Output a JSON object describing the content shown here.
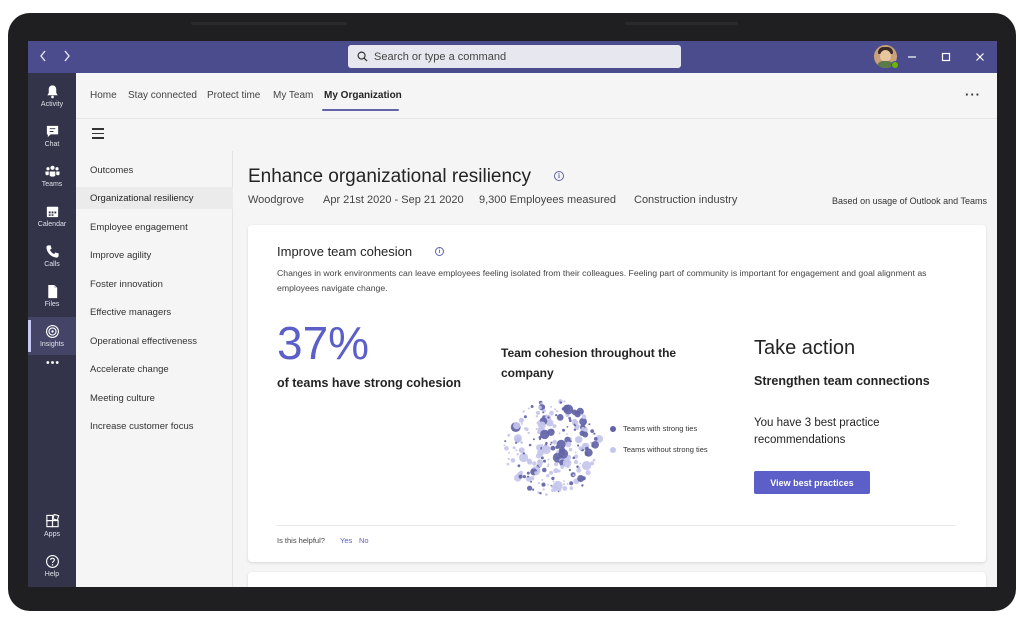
{
  "search": {
    "placeholder": "Search or type a command"
  },
  "rail": [
    {
      "label": "Activity",
      "icon": "bell-icon"
    },
    {
      "label": "Chat",
      "icon": "chat-icon"
    },
    {
      "label": "Teams",
      "icon": "teams-icon"
    },
    {
      "label": "Calendar",
      "icon": "calendar-icon"
    },
    {
      "label": "Calls",
      "icon": "phone-icon"
    },
    {
      "label": "Files",
      "icon": "file-icon"
    },
    {
      "label": "Insights",
      "icon": "insights-icon",
      "active": true
    },
    {
      "label": "Apps",
      "icon": "apps-icon"
    },
    {
      "label": "Help",
      "icon": "help-icon"
    }
  ],
  "tabs": [
    {
      "label": "Home"
    },
    {
      "label": "Stay connected"
    },
    {
      "label": "Protect time"
    },
    {
      "label": "My Team"
    },
    {
      "label": "My Organization",
      "active": true
    }
  ],
  "sidenav": [
    {
      "label": "Outcomes"
    },
    {
      "label": "Organizational resiliency",
      "active": true
    },
    {
      "label": "Employee engagement"
    },
    {
      "label": "Improve agility"
    },
    {
      "label": "Foster innovation"
    },
    {
      "label": "Effective managers"
    },
    {
      "label": "Operational effectiveness"
    },
    {
      "label": "Accelerate change"
    },
    {
      "label": "Meeting culture"
    },
    {
      "label": "Increase customer focus"
    }
  ],
  "page": {
    "title": "Enhance organizational resiliency",
    "org": "Woodgrove",
    "date_range": "Apr 21st 2020 - Sep 21 2020",
    "employees": "9,300 Employees measured",
    "industry": "Construction industry",
    "basis": "Based on usage of Outlook and Teams"
  },
  "card": {
    "title": "Improve team cohesion",
    "description": "Changes in work environments can leave employees feeling isolated from their colleagues. Feeling part of community is important for engagement and goal alignment as employees navigate change.",
    "stat_value": "37%",
    "stat_label": "of teams have strong cohesion",
    "chart_title": "Team cohesion throughout the company",
    "legend": [
      {
        "label": "Teams with strong ties",
        "color": "#6264a7"
      },
      {
        "label": "Teams without strong ties",
        "color": "#c5c6ec"
      }
    ],
    "action_title": "Take action",
    "action_subtitle": "Strengthen team connections",
    "action_desc": "You have 3 best practice recommendations",
    "action_button": "View best practices",
    "helpful_q": "Is this helpful?",
    "helpful_yes": "Yes",
    "helpful_no": "No"
  },
  "colors": {
    "accent": "#6264a7",
    "accent_light": "#c5c6ec",
    "titlebar": "#4b4c8e",
    "rail": "#33344a"
  }
}
